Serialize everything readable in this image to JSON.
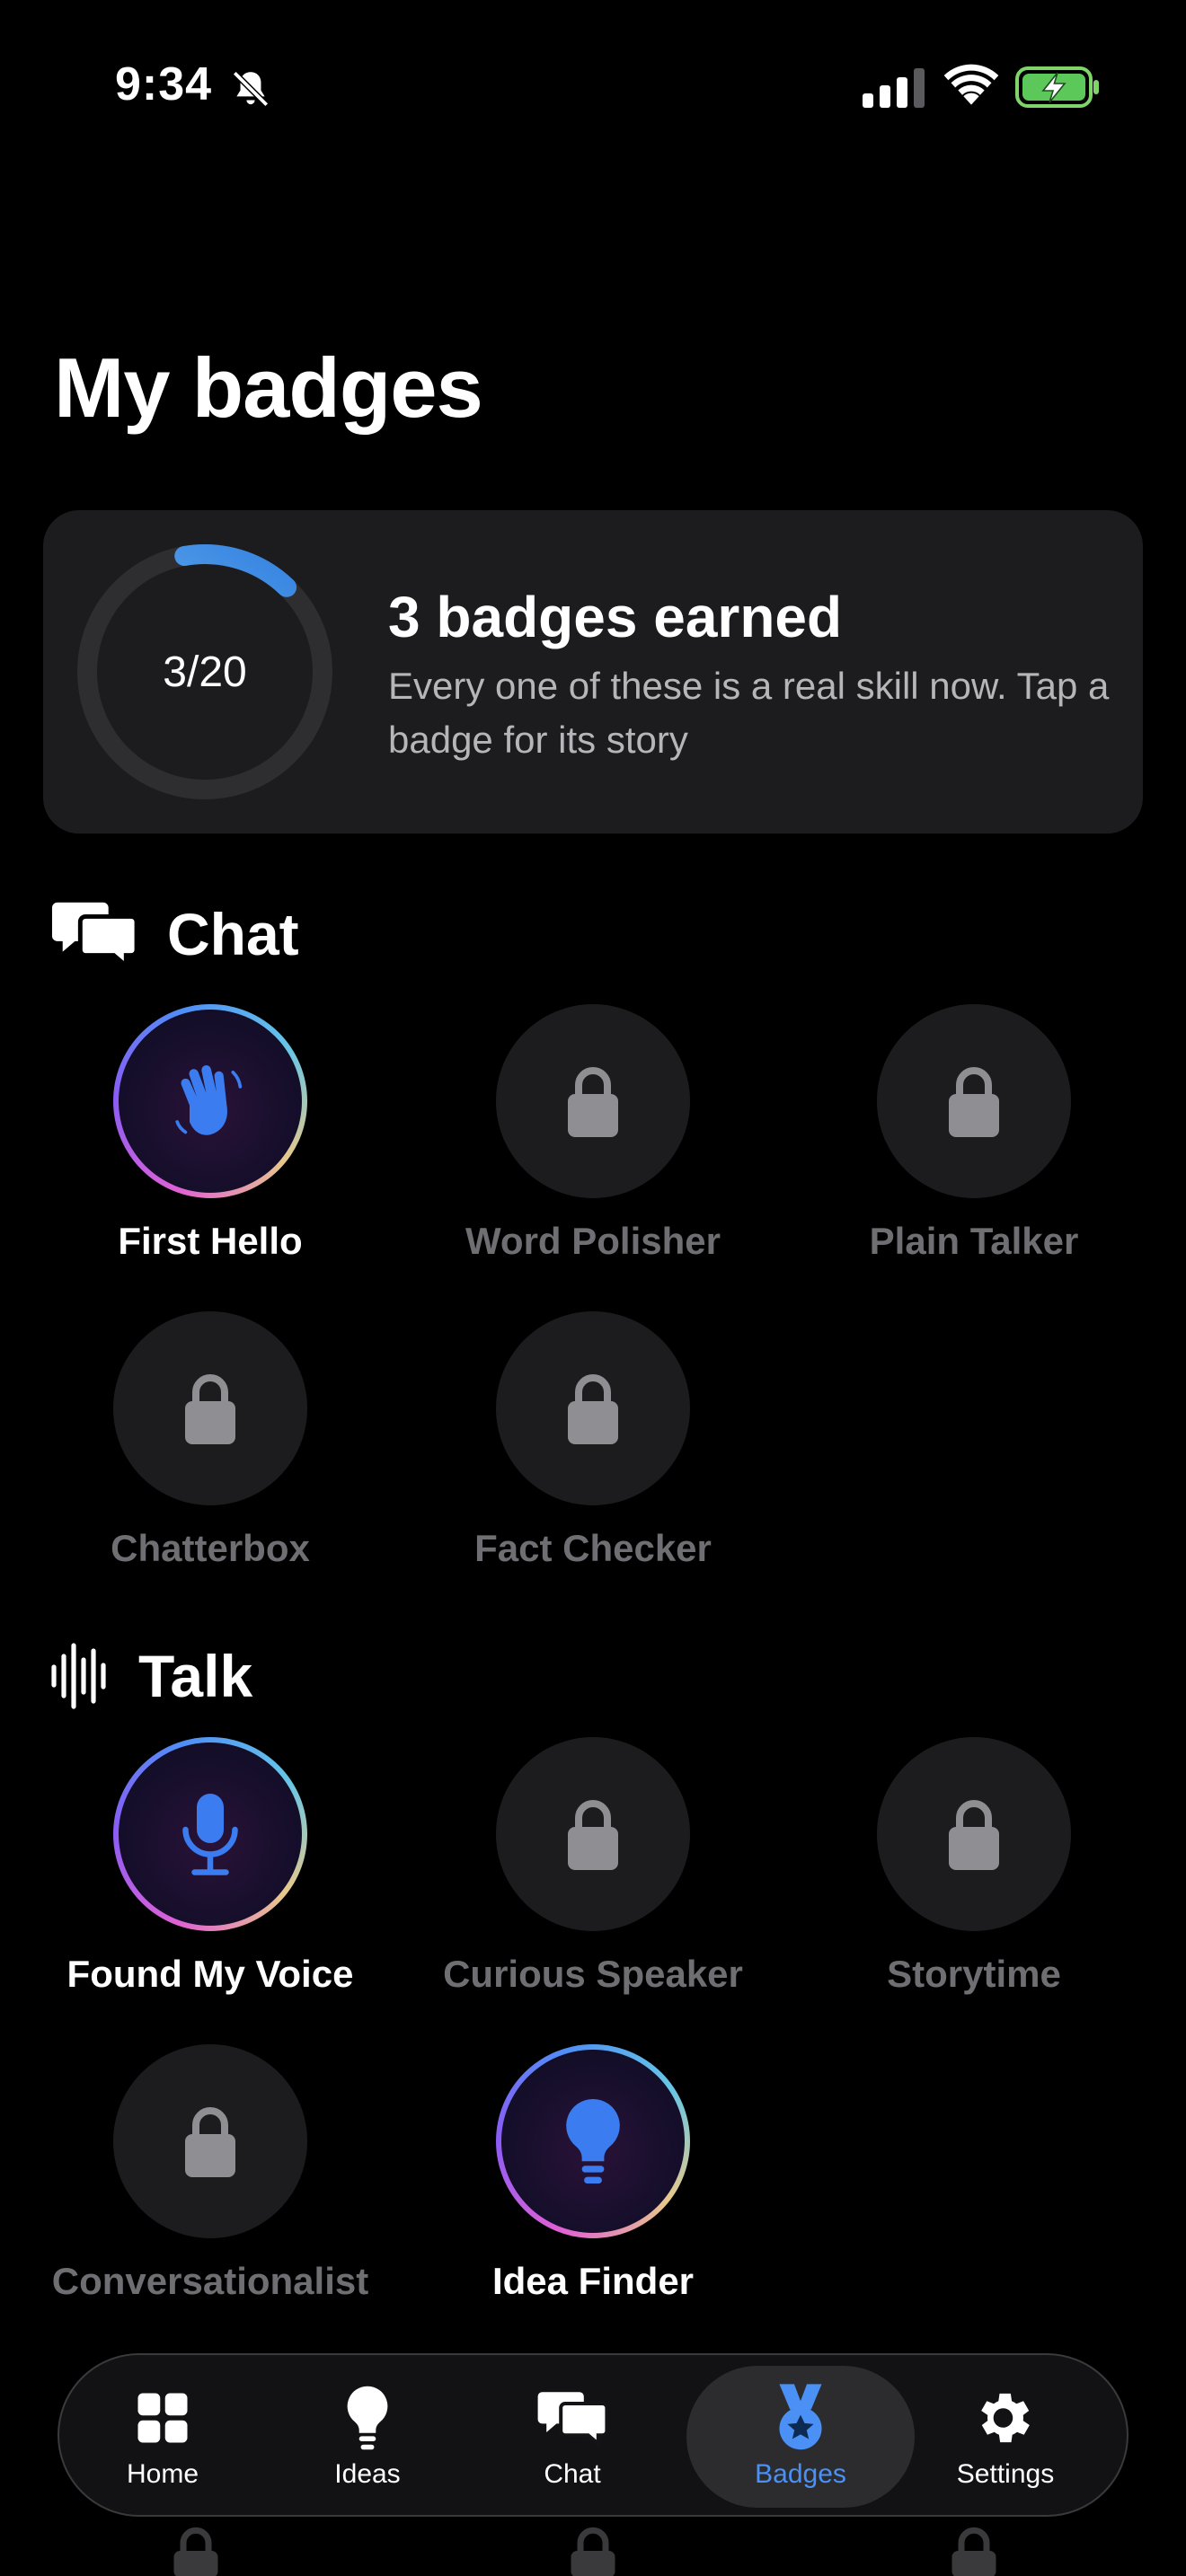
{
  "status_bar": {
    "time": "9:34",
    "icons": [
      "bell-slash-icon",
      "signal-icon",
      "wifi-icon",
      "battery-charging-icon"
    ]
  },
  "page": {
    "title": "My badges"
  },
  "summary": {
    "progress_label": "3/20",
    "earned": 3,
    "total": 20,
    "headline": "3 badges earned",
    "subtitle": "Every one of these is a real skill now. Tap a badge for its story"
  },
  "sections": {
    "chat": {
      "title": "Chat",
      "icon": "chat-bubbles-icon",
      "badges": [
        {
          "name": "First Hello",
          "earned": true,
          "icon": "waving-hand-icon"
        },
        {
          "name": "Word Polisher",
          "earned": false,
          "icon": "lock-icon"
        },
        {
          "name": "Plain Talker",
          "earned": false,
          "icon": "lock-icon"
        },
        {
          "name": "Chatterbox",
          "earned": false,
          "icon": "lock-icon"
        },
        {
          "name": "Fact Checker",
          "earned": false,
          "icon": "lock-icon"
        }
      ]
    },
    "talk": {
      "title": "Talk",
      "icon": "waveform-icon",
      "badges": [
        {
          "name": "Found My Voice",
          "earned": true,
          "icon": "microphone-icon"
        },
        {
          "name": "Curious Speaker",
          "earned": false,
          "icon": "lock-icon"
        },
        {
          "name": "Storytime",
          "earned": false,
          "icon": "lock-icon"
        },
        {
          "name": "Conversationalist",
          "earned": false,
          "icon": "lock-icon"
        },
        {
          "name": "Idea Finder",
          "earned": true,
          "icon": "lightbulb-icon"
        }
      ]
    }
  },
  "tab_bar": {
    "tabs": [
      {
        "label": "Home",
        "icon": "grid-icon",
        "active": false
      },
      {
        "label": "Ideas",
        "icon": "lightbulb-icon",
        "active": false
      },
      {
        "label": "Chat",
        "icon": "chat-bubbles-icon",
        "active": false
      },
      {
        "label": "Badges",
        "icon": "medal-icon",
        "active": true
      },
      {
        "label": "Settings",
        "icon": "gear-icon",
        "active": false
      }
    ]
  },
  "colors": {
    "accent": "#4a90f5",
    "background": "#000000",
    "card": "#1c1c1e",
    "locked_text": "#6e6e73"
  }
}
